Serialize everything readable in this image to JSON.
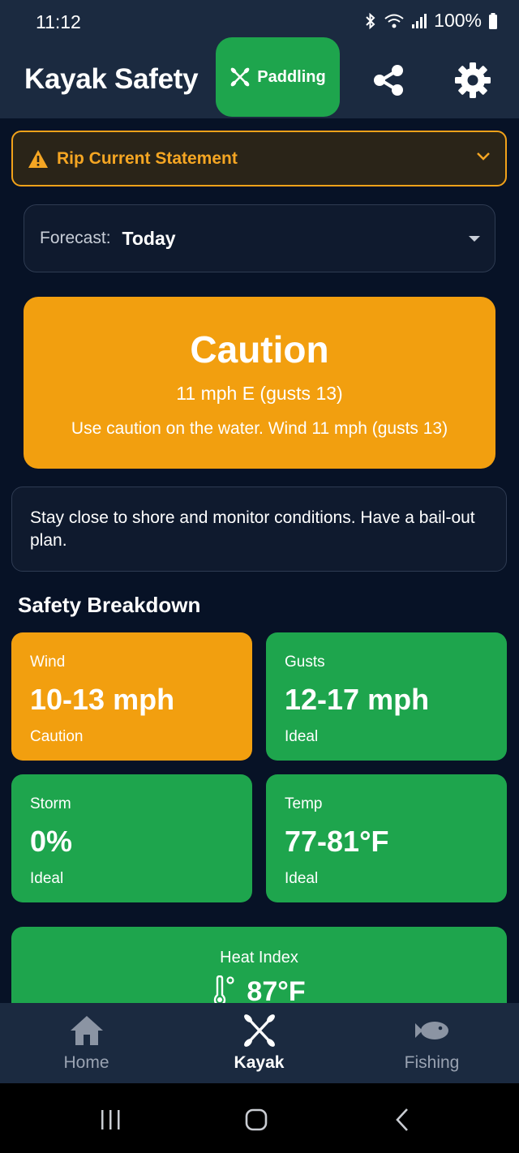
{
  "status_bar": {
    "time": "11:12",
    "battery": "100%"
  },
  "app": {
    "title": "Kayak Safety",
    "mode_label": "Paddling"
  },
  "alert": {
    "label": "Rip Current Statement"
  },
  "forecast": {
    "label": "Forecast:",
    "value": "Today"
  },
  "status": {
    "title": "Caution",
    "wind": "11 mph E (gusts 13)",
    "message": "Use caution on the water. Wind 11 mph (gusts 13)",
    "color": "#f29f0f"
  },
  "advice": "Stay close to shore and monitor conditions. Have a bail-out plan.",
  "breakdown": {
    "title": "Safety Breakdown",
    "tiles": [
      {
        "label": "Wind",
        "value": "10-13 mph",
        "status": "Caution",
        "color": "#f29f0f"
      },
      {
        "label": "Gusts",
        "value": "12-17 mph",
        "status": "Ideal",
        "color": "#1ea54d"
      },
      {
        "label": "Storm",
        "value": "0%",
        "status": "Ideal",
        "color": "#1ea54d"
      },
      {
        "label": "Temp",
        "value": "77-81°F",
        "status": "Ideal",
        "color": "#1ea54d"
      }
    ],
    "heat_index": {
      "label": "Heat Index",
      "value": "87°F",
      "icon": "thermometer-icon"
    }
  },
  "bottom_nav": [
    {
      "label": "Home",
      "icon": "home-icon",
      "active": false
    },
    {
      "label": "Kayak",
      "icon": "kayak-paddle-icon",
      "active": true
    },
    {
      "label": "Fishing",
      "icon": "fish-icon",
      "active": false
    }
  ],
  "colors": {
    "caution": "#f29f0f",
    "ideal": "#1ea54d",
    "background": "#071226",
    "bar": "#1b2a40"
  }
}
